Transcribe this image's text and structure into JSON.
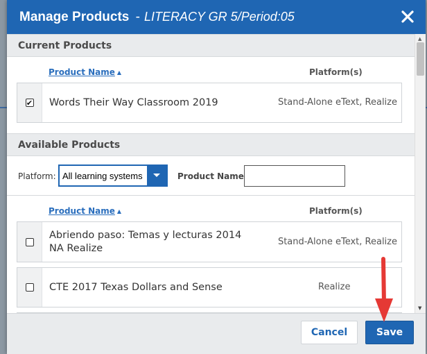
{
  "dialog": {
    "title": "Manage Products",
    "separator": "-",
    "subtitle": "LITERACY GR 5/Period:05"
  },
  "current_section": {
    "title": "Current Products",
    "col_name": "Product Name",
    "col_platform": "Platform(s)",
    "products": [
      {
        "name": "Words Their Way Classroom 2019",
        "platform": "Stand-Alone eText, Realize",
        "checked": true
      }
    ]
  },
  "available_section": {
    "title": "Available Products",
    "platform_label": "Platform:",
    "platform_value": "All learning systems",
    "name_label": "Product Name:",
    "name_value": "",
    "col_name": "Product Name",
    "col_platform": "Platform(s)",
    "products": [
      {
        "name": "Abriendo paso: Temas y lecturas 2014 NA Realize",
        "platform": "Stand-Alone eText, Realize",
        "checked": false
      },
      {
        "name": "CTE 2017 Texas Dollars and Sense",
        "platform": "Realize",
        "checked": false
      }
    ]
  },
  "footer": {
    "cancel_label": "Cancel",
    "save_label": "Save"
  },
  "colors": {
    "header_blue": "#1f66b3",
    "link_blue": "#2a6ebd",
    "section_gray": "#e9ebed",
    "annotation_red": "#e53935"
  },
  "icons": {
    "close": "close-icon",
    "sort": "caret-up-icon",
    "dropdown": "chevron-down-icon"
  }
}
